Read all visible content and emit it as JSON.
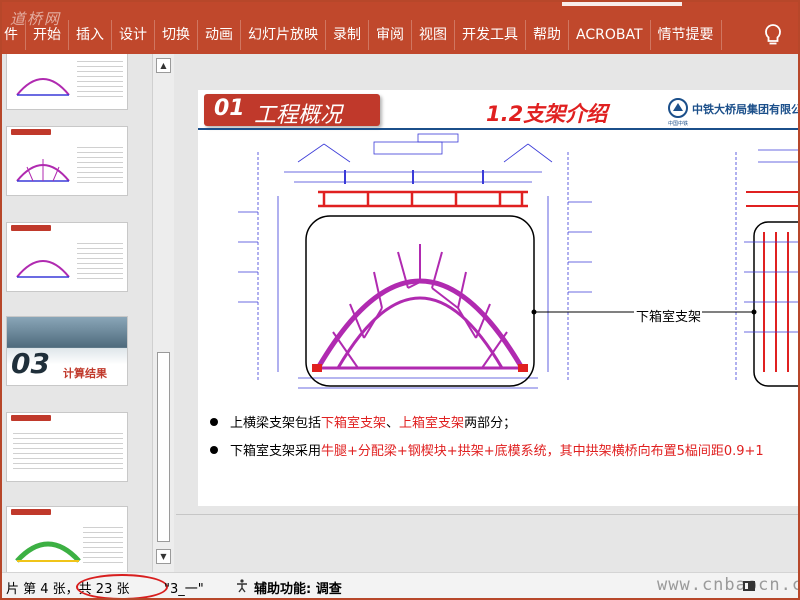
{
  "ribbon": {
    "logo_text": "道桥网",
    "tabs": [
      "件",
      "开始",
      "插入",
      "设计",
      "切换",
      "动画",
      "幻灯片放映",
      "录制",
      "审阅",
      "视图",
      "开发工具",
      "帮助",
      "ACROBAT",
      "情节提要"
    ],
    "tip_icon": "lightbulb-icon"
  },
  "thumbnails": {
    "section_number": "03",
    "section_caption": "计算结果"
  },
  "slide": {
    "title_number": "01",
    "title_text": "工程概况",
    "subtitle": "1.2支架介绍",
    "company_name": "中铁大桥局集团有限公",
    "company_sub": "中国中铁",
    "callout": "下箱室支架",
    "bullets": [
      [
        {
          "text": "上横梁支架包括",
          "red": false
        },
        {
          "text": "下箱室支架",
          "red": true
        },
        {
          "text": "、",
          "red": false
        },
        {
          "text": "上箱室支架",
          "red": true
        },
        {
          "text": "两部分；",
          "red": false
        }
      ],
      [
        {
          "text": "下箱室支架采用",
          "red": false
        },
        {
          "text": "牛腿+分配梁+钢楔块+拱架+底模系统，其中拱架横桥向布置5榀间距0.9+1",
          "red": true
        }
      ]
    ]
  },
  "status": {
    "slide_counter": "片 第 4 张，共 23 张",
    "theme_name": "\"3_一\"",
    "accessibility": "辅助功能: 调查",
    "watermark": "www.cnbaocn.com"
  },
  "colors": {
    "ribbon": "#c0482c",
    "accent_red": "#e02020",
    "title_box": "#c0392b",
    "company_blue": "#1b4f8a",
    "drawing_blue": "#3a3ad8",
    "arch_magenta": "#b02ab0",
    "highlight_circle": "#d81e1e"
  }
}
